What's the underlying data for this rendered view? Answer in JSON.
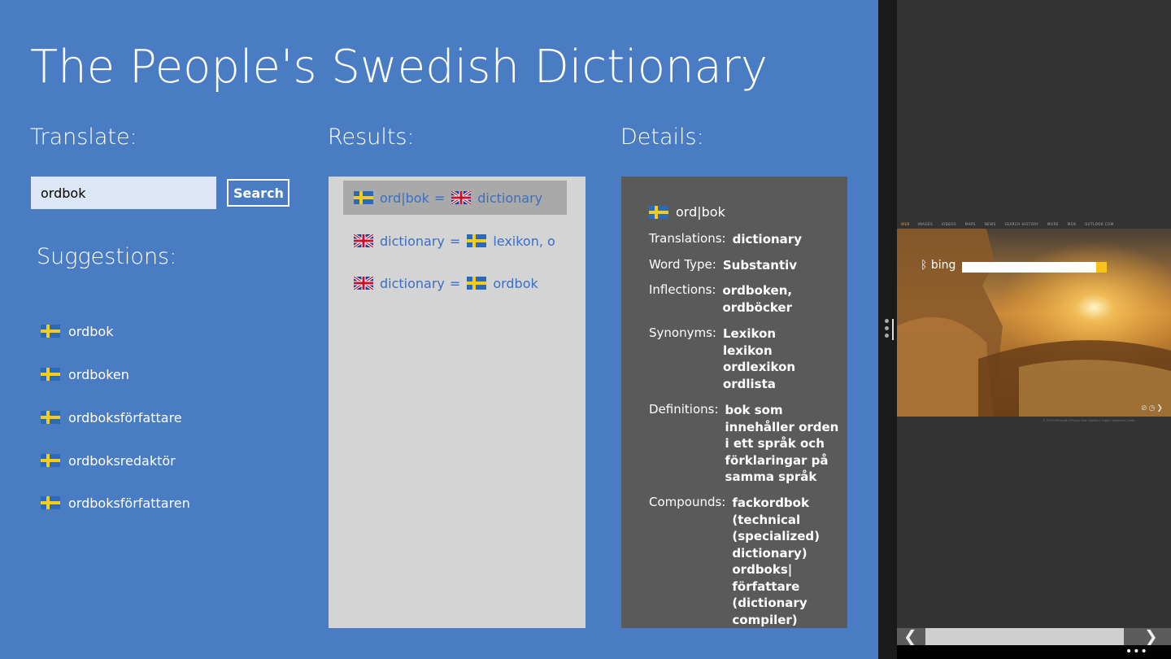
{
  "app": {
    "title": "The People's Swedish Dictionary"
  },
  "translate": {
    "heading": "Translate:",
    "input_value": "ordbok",
    "search_label": "Search"
  },
  "suggestions": {
    "heading": "Suggestions:",
    "items": [
      "ordbok",
      "ordboken",
      "ordboksförfattare",
      "ordboksredaktör",
      "ordboksförfattaren"
    ]
  },
  "results": {
    "heading": "Results:",
    "rows": [
      {
        "from": "ord|bok",
        "eq": "=",
        "to": "dictionary",
        "from_lang": "swedish-flag-icon",
        "to_lang": "uk-flag-icon",
        "selected": true
      },
      {
        "from": "dictionary",
        "eq": "=",
        "to": "lexikon, o",
        "from_lang": "uk-flag-icon",
        "to_lang": "swedish-flag-icon",
        "selected": false
      },
      {
        "from": "dictionary",
        "eq": "=",
        "to": "ordbok",
        "from_lang": "uk-flag-icon",
        "to_lang": "swedish-flag-icon",
        "selected": false
      }
    ]
  },
  "details": {
    "heading": "Details:",
    "word": "ord|bok",
    "translations_label": "Translations:",
    "translations": "dictionary",
    "word_type_label": "Word Type:",
    "word_type": "Substantiv",
    "inflections_label": "Inflections:",
    "inflections": [
      "ordboken,",
      "ordböcker"
    ],
    "synonyms_label": "Synonyms:",
    "synonyms": [
      "Lexikon",
      "lexikon",
      "ordlexikon",
      "ordlista"
    ],
    "definitions_label": "Definitions:",
    "definitions": [
      "bok som",
      "innehåller orden",
      "i ett språk och",
      "förklaringar på",
      "samma språk"
    ],
    "compounds_label": "Compounds:",
    "compounds": [
      "fackordbok",
      "(technical",
      "(specialized)",
      "dictionary)",
      "ordboks|",
      "författare",
      "(dictionary",
      "compiler)"
    ]
  },
  "snapped_app": {
    "logo": "bing",
    "nav": [
      "IMAGES",
      "VIDEOS",
      "MAPS",
      "NEWS",
      "SEARCH HISTORY",
      "MORE",
      "MSN",
      "OUTLOOK.COM"
    ],
    "nav_active": "WEB",
    "footer": "© 2013 Microsoft  |  Privacy and Cookies  |  Legal  |  Advertise  |  Help",
    "controls": "⊘◷❯",
    "more_dots": "•••"
  },
  "colors": {
    "app_bg": "#4a7cc3",
    "results_bg": "#d4d4d4",
    "details_bg": "#5a5a5a",
    "link": "#3a6fc2",
    "selected": "#a9a9a9"
  }
}
